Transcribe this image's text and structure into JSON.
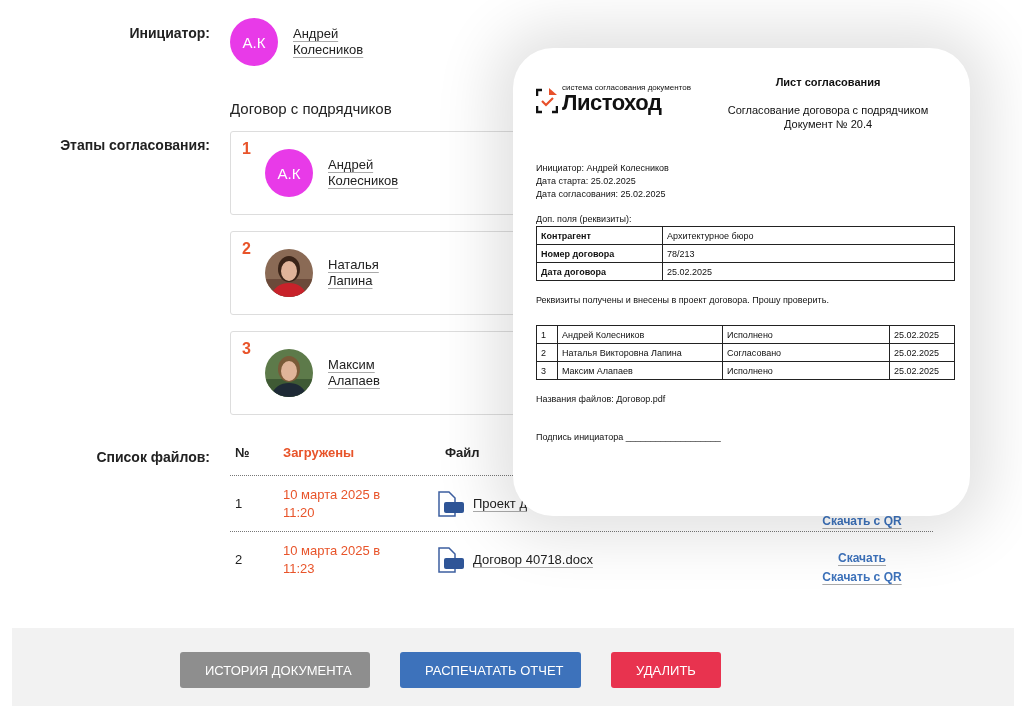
{
  "initiator": {
    "label": "Инициатор:",
    "initials": "А.К",
    "name": "Андрей Колесников"
  },
  "document_title": "Договор с подрядчиков",
  "stages": {
    "label": "Этапы согласования:",
    "items": [
      {
        "number": "1",
        "kind": "initials",
        "initials": "А.К",
        "name": "Андрей Колесников"
      },
      {
        "number": "2",
        "name": "Наталья Лапина"
      },
      {
        "number": "3",
        "name": "Максим Алапаев"
      }
    ]
  },
  "files": {
    "label": "Список файлов:",
    "columns": [
      "№",
      "Загружены",
      "Файл"
    ],
    "rows": [
      {
        "number": "1",
        "uploaded": "10 марта 2025 в 11:20",
        "name": "Проект д",
        "links": [
          "Скачать с QR"
        ]
      },
      {
        "number": "2",
        "uploaded": "10 марта 2025 в 11:23",
        "name": "Договор 40718.docx",
        "links": [
          "Скачать",
          "Скачать с QR"
        ]
      }
    ]
  },
  "actions": [
    {
      "label": "ИСТОРИЯ ДОКУМЕНТА",
      "kind": "history"
    },
    {
      "label": "РАСПЕЧАТАТЬ ОТЧЕТ",
      "kind": "print"
    },
    {
      "label": "УДАЛИТЬ",
      "kind": "delete"
    }
  ],
  "report": {
    "logo": {
      "tagline": "система согласования документов",
      "name": "Листоход"
    },
    "title": "Лист согласования",
    "subtitle": [
      "Согласование договора с подрядчиком",
      "Документ № 20.4"
    ],
    "info": [
      "Инициатор: Андрей  Колесников",
      "Дата старта: 25.02.2025",
      "Дата согласования: 25.02.2025"
    ],
    "fields_label": "Доп. поля (реквизиты):",
    "fields": [
      {
        "name": "Контрагент",
        "value": "Архитектурное бюро"
      },
      {
        "name": "Номер договора",
        "value": "78/213"
      },
      {
        "name": "Дата договора",
        "value": "25.02.2025"
      }
    ],
    "message": "Реквизиты получены и внесены в проект договора. Прошу проверить.",
    "approvals": [
      [
        "1",
        "Андрей  Колесников",
        "Исполнено",
        "25.02.2025"
      ],
      [
        "2",
        "Наталья Викторовна Лапина",
        "Согласовано",
        "25.02.2025"
      ],
      [
        "3",
        "Максим  Алапаев",
        "Исполнено",
        "25.02.2025"
      ]
    ],
    "files_line": "Названия файлов: Договор.pdf",
    "signature": "Подпись инициатора ___________________"
  }
}
